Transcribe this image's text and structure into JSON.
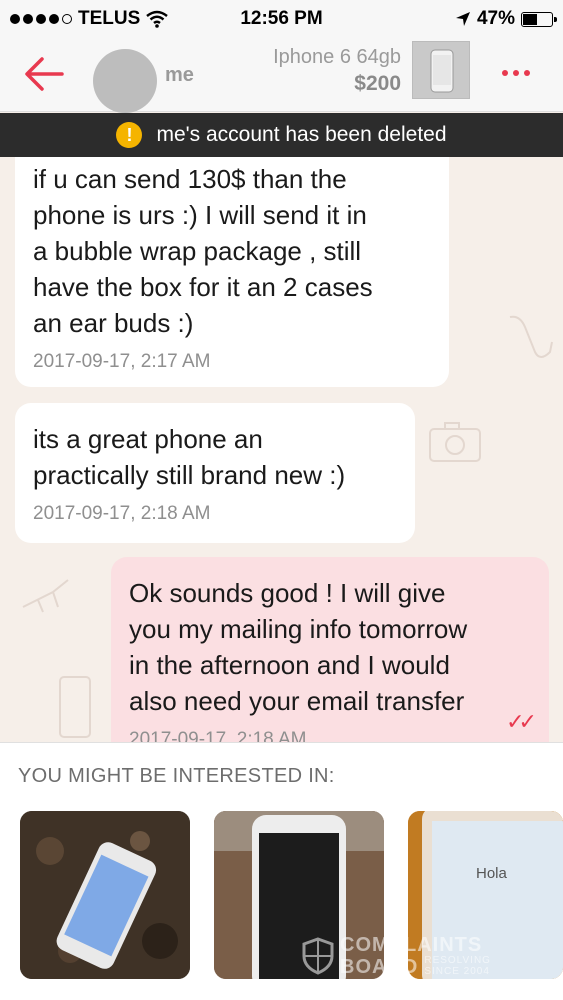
{
  "status_bar": {
    "carrier": "TELUS",
    "time": "12:56 PM",
    "battery": "47%",
    "battery_level": 0.47
  },
  "header": {
    "username": "me",
    "item_title": "Iphone 6 64gb",
    "item_price": "$200",
    "icons": [
      "back-arrow-icon",
      "more-dots-icon"
    ],
    "accent_color": "#e8394f"
  },
  "banner": {
    "icon": "warning-icon",
    "text": "me's account has been deleted"
  },
  "messages": [
    {
      "lines": [
        "if u can send 130$ than the",
        "phone is urs :) I will send it in",
        "a bubble wrap package , still",
        "have the box for it an 2 cases",
        "an ear buds :)"
      ],
      "time": "2017-09-17, 2:17 AM",
      "direction": "incoming"
    },
    {
      "lines": [
        "its a great phone an",
        "practically still brand new :)"
      ],
      "time": "2017-09-17, 2:18 AM",
      "direction": "incoming"
    },
    {
      "lines": [
        "Ok sounds good ! I will give",
        "you my mailing info tomorrow",
        "in the afternoon and I would",
        "also need your email transfer"
      ],
      "time": "2017-09-17, 2:18 AM",
      "direction": "outgoing",
      "read_ticks": "✓✓"
    }
  ],
  "suggestions": {
    "title": "YOU MIGHT BE INTERESTED IN:",
    "card3_screen_text": "Hola"
  },
  "watermark": {
    "line1": "COMPLAINTS",
    "line2": "BOARD",
    "line3": "RESOLVING",
    "line4": "SINCE 2004"
  }
}
